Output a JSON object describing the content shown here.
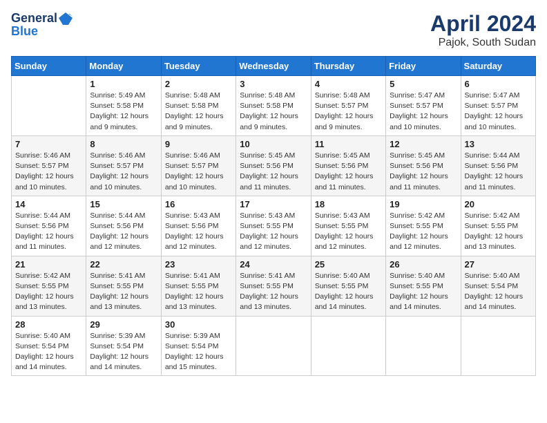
{
  "header": {
    "logo_line1": "General",
    "logo_line2": "Blue",
    "title": "April 2024",
    "subtitle": "Pajok, South Sudan"
  },
  "days_of_week": [
    "Sunday",
    "Monday",
    "Tuesday",
    "Wednesday",
    "Thursday",
    "Friday",
    "Saturday"
  ],
  "weeks": [
    [
      {
        "day": "",
        "info": ""
      },
      {
        "day": "1",
        "info": "Sunrise: 5:49 AM\nSunset: 5:58 PM\nDaylight: 12 hours\nand 9 minutes."
      },
      {
        "day": "2",
        "info": "Sunrise: 5:48 AM\nSunset: 5:58 PM\nDaylight: 12 hours\nand 9 minutes."
      },
      {
        "day": "3",
        "info": "Sunrise: 5:48 AM\nSunset: 5:58 PM\nDaylight: 12 hours\nand 9 minutes."
      },
      {
        "day": "4",
        "info": "Sunrise: 5:48 AM\nSunset: 5:57 PM\nDaylight: 12 hours\nand 9 minutes."
      },
      {
        "day": "5",
        "info": "Sunrise: 5:47 AM\nSunset: 5:57 PM\nDaylight: 12 hours\nand 10 minutes."
      },
      {
        "day": "6",
        "info": "Sunrise: 5:47 AM\nSunset: 5:57 PM\nDaylight: 12 hours\nand 10 minutes."
      }
    ],
    [
      {
        "day": "7",
        "info": "Sunrise: 5:46 AM\nSunset: 5:57 PM\nDaylight: 12 hours\nand 10 minutes."
      },
      {
        "day": "8",
        "info": "Sunrise: 5:46 AM\nSunset: 5:57 PM\nDaylight: 12 hours\nand 10 minutes."
      },
      {
        "day": "9",
        "info": "Sunrise: 5:46 AM\nSunset: 5:57 PM\nDaylight: 12 hours\nand 10 minutes."
      },
      {
        "day": "10",
        "info": "Sunrise: 5:45 AM\nSunset: 5:56 PM\nDaylight: 12 hours\nand 11 minutes."
      },
      {
        "day": "11",
        "info": "Sunrise: 5:45 AM\nSunset: 5:56 PM\nDaylight: 12 hours\nand 11 minutes."
      },
      {
        "day": "12",
        "info": "Sunrise: 5:45 AM\nSunset: 5:56 PM\nDaylight: 12 hours\nand 11 minutes."
      },
      {
        "day": "13",
        "info": "Sunrise: 5:44 AM\nSunset: 5:56 PM\nDaylight: 12 hours\nand 11 minutes."
      }
    ],
    [
      {
        "day": "14",
        "info": "Sunrise: 5:44 AM\nSunset: 5:56 PM\nDaylight: 12 hours\nand 11 minutes."
      },
      {
        "day": "15",
        "info": "Sunrise: 5:44 AM\nSunset: 5:56 PM\nDaylight: 12 hours\nand 12 minutes."
      },
      {
        "day": "16",
        "info": "Sunrise: 5:43 AM\nSunset: 5:56 PM\nDaylight: 12 hours\nand 12 minutes."
      },
      {
        "day": "17",
        "info": "Sunrise: 5:43 AM\nSunset: 5:55 PM\nDaylight: 12 hours\nand 12 minutes."
      },
      {
        "day": "18",
        "info": "Sunrise: 5:43 AM\nSunset: 5:55 PM\nDaylight: 12 hours\nand 12 minutes."
      },
      {
        "day": "19",
        "info": "Sunrise: 5:42 AM\nSunset: 5:55 PM\nDaylight: 12 hours\nand 12 minutes."
      },
      {
        "day": "20",
        "info": "Sunrise: 5:42 AM\nSunset: 5:55 PM\nDaylight: 12 hours\nand 13 minutes."
      }
    ],
    [
      {
        "day": "21",
        "info": "Sunrise: 5:42 AM\nSunset: 5:55 PM\nDaylight: 12 hours\nand 13 minutes."
      },
      {
        "day": "22",
        "info": "Sunrise: 5:41 AM\nSunset: 5:55 PM\nDaylight: 12 hours\nand 13 minutes."
      },
      {
        "day": "23",
        "info": "Sunrise: 5:41 AM\nSunset: 5:55 PM\nDaylight: 12 hours\nand 13 minutes."
      },
      {
        "day": "24",
        "info": "Sunrise: 5:41 AM\nSunset: 5:55 PM\nDaylight: 12 hours\nand 13 minutes."
      },
      {
        "day": "25",
        "info": "Sunrise: 5:40 AM\nSunset: 5:55 PM\nDaylight: 12 hours\nand 14 minutes."
      },
      {
        "day": "26",
        "info": "Sunrise: 5:40 AM\nSunset: 5:55 PM\nDaylight: 12 hours\nand 14 minutes."
      },
      {
        "day": "27",
        "info": "Sunrise: 5:40 AM\nSunset: 5:54 PM\nDaylight: 12 hours\nand 14 minutes."
      }
    ],
    [
      {
        "day": "28",
        "info": "Sunrise: 5:40 AM\nSunset: 5:54 PM\nDaylight: 12 hours\nand 14 minutes."
      },
      {
        "day": "29",
        "info": "Sunrise: 5:39 AM\nSunset: 5:54 PM\nDaylight: 12 hours\nand 14 minutes."
      },
      {
        "day": "30",
        "info": "Sunrise: 5:39 AM\nSunset: 5:54 PM\nDaylight: 12 hours\nand 15 minutes."
      },
      {
        "day": "",
        "info": ""
      },
      {
        "day": "",
        "info": ""
      },
      {
        "day": "",
        "info": ""
      },
      {
        "day": "",
        "info": ""
      }
    ]
  ]
}
